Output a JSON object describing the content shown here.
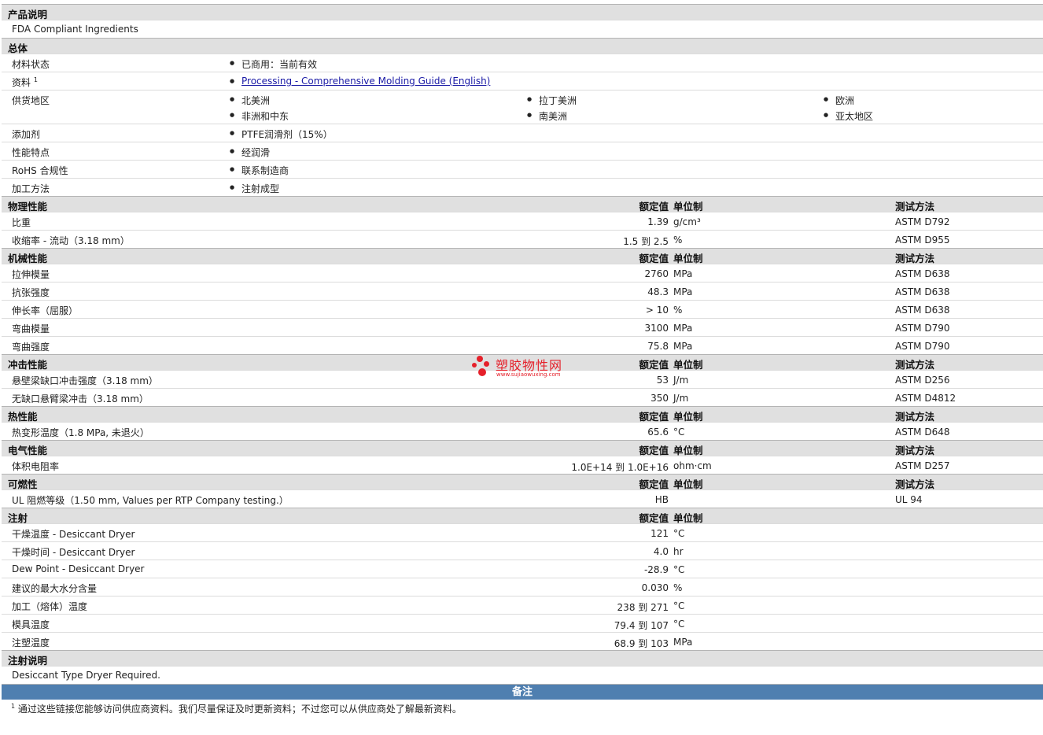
{
  "product_description": {
    "title": "产品说明",
    "text": "FDA Compliant Ingredients"
  },
  "general": {
    "title": "总体",
    "material_status": {
      "label": "材料状态",
      "value": "已商用：当前有效"
    },
    "literature": {
      "label": "资料",
      "sup": "1",
      "link": "Processing - Comprehensive Molding Guide (English)"
    },
    "availability": {
      "label": "供货地区",
      "items": [
        "北美洲",
        "拉丁美洲",
        "欧洲",
        "非洲和中东",
        "南美洲",
        "亚太地区"
      ]
    },
    "additive": {
      "label": "添加剂",
      "value": "PTFE润滑剂（15%）"
    },
    "features": {
      "label": "性能特点",
      "value": "经润滑"
    },
    "rohs": {
      "label": "RoHS 合规性",
      "value": "联系制造商"
    },
    "processing": {
      "label": "加工方法",
      "value": "注射成型"
    }
  },
  "headers": {
    "nominal": "额定值",
    "unit": "单位制",
    "method": "测试方法"
  },
  "sections": [
    {
      "title": "物理性能",
      "method_hdr": true,
      "rows": [
        {
          "label": "比重",
          "value": "1.39",
          "unit": "g/cm³",
          "method": "ASTM D792"
        },
        {
          "label": "收缩率 - 流动（3.18 mm）",
          "value": "1.5 到  2.5",
          "unit": "%",
          "method": "ASTM D955"
        }
      ]
    },
    {
      "title": "机械性能",
      "method_hdr": true,
      "rows": [
        {
          "label": "拉伸模量",
          "value": "2760",
          "unit": "MPa",
          "method": "ASTM D638"
        },
        {
          "label": "抗张强度",
          "value": "48.3",
          "unit": "MPa",
          "method": "ASTM D638"
        },
        {
          "label": "伸长率（屈服）",
          "value": "> 10",
          "unit": "%",
          "method": "ASTM D638"
        },
        {
          "label": "弯曲模量",
          "value": "3100",
          "unit": "MPa",
          "method": "ASTM D790"
        },
        {
          "label": "弯曲强度",
          "value": "75.8",
          "unit": "MPa",
          "method": "ASTM D790"
        }
      ]
    },
    {
      "title": "冲击性能",
      "method_hdr": true,
      "rows": [
        {
          "label": "悬壁梁缺口冲击强度（3.18 mm）",
          "value": "53",
          "unit": "J/m",
          "method": "ASTM D256"
        },
        {
          "label": "无缺口悬臂梁冲击（3.18 mm）",
          "value": "350",
          "unit": "J/m",
          "method": "ASTM D4812"
        }
      ]
    },
    {
      "title": "热性能",
      "method_hdr": true,
      "rows": [
        {
          "label": "热变形温度（1.8 MPa, 未退火）",
          "value": "65.6",
          "unit": "°C",
          "method": "ASTM D648"
        }
      ]
    },
    {
      "title": "电气性能",
      "method_hdr": true,
      "rows": [
        {
          "label": "体积电阻率",
          "value": "1.0E+14 到  1.0E+16",
          "unit": "ohm·cm",
          "method": "ASTM D257"
        }
      ]
    },
    {
      "title": "可燃性",
      "method_hdr": true,
      "rows": [
        {
          "label": "UL 阻燃等级（1.50 mm, Values per RTP Company testing.）",
          "value": "HB",
          "unit": "",
          "method": "UL 94"
        }
      ]
    },
    {
      "title": "注射",
      "method_hdr": false,
      "rows": [
        {
          "label": "干燥温度 - Desiccant Dryer",
          "value": "121",
          "unit": "°C",
          "method": ""
        },
        {
          "label": "干燥时间 - Desiccant Dryer",
          "value": "4.0",
          "unit": "hr",
          "method": ""
        },
        {
          "label": "Dew Point - Desiccant Dryer",
          "value": "-28.9",
          "unit": "°C",
          "method": ""
        },
        {
          "label": "建议的最大水分含量",
          "value": "0.030",
          "unit": "%",
          "method": ""
        },
        {
          "label": "加工（熔体）温度",
          "value": "238 到  271",
          "unit": "°C",
          "method": ""
        },
        {
          "label": "模具温度",
          "value": "79.4 到  107",
          "unit": "°C",
          "method": ""
        },
        {
          "label": "注塑温度",
          "value": "68.9 到  103",
          "unit": "MPa",
          "method": ""
        }
      ]
    }
  ],
  "injection_notes": {
    "title": "注射说明",
    "text": "Desiccant Type Dryer Required."
  },
  "notes": {
    "title": "备注",
    "sup": "1",
    "text": "通过这些链接您能够访问供应商资料。我们尽量保证及时更新资料；不过您可以从供应商处了解最新资料。"
  },
  "watermark": {
    "name": "塑胶物性网",
    "url": "www.sujiaowuxing.com",
    "color": "#e5202a"
  }
}
